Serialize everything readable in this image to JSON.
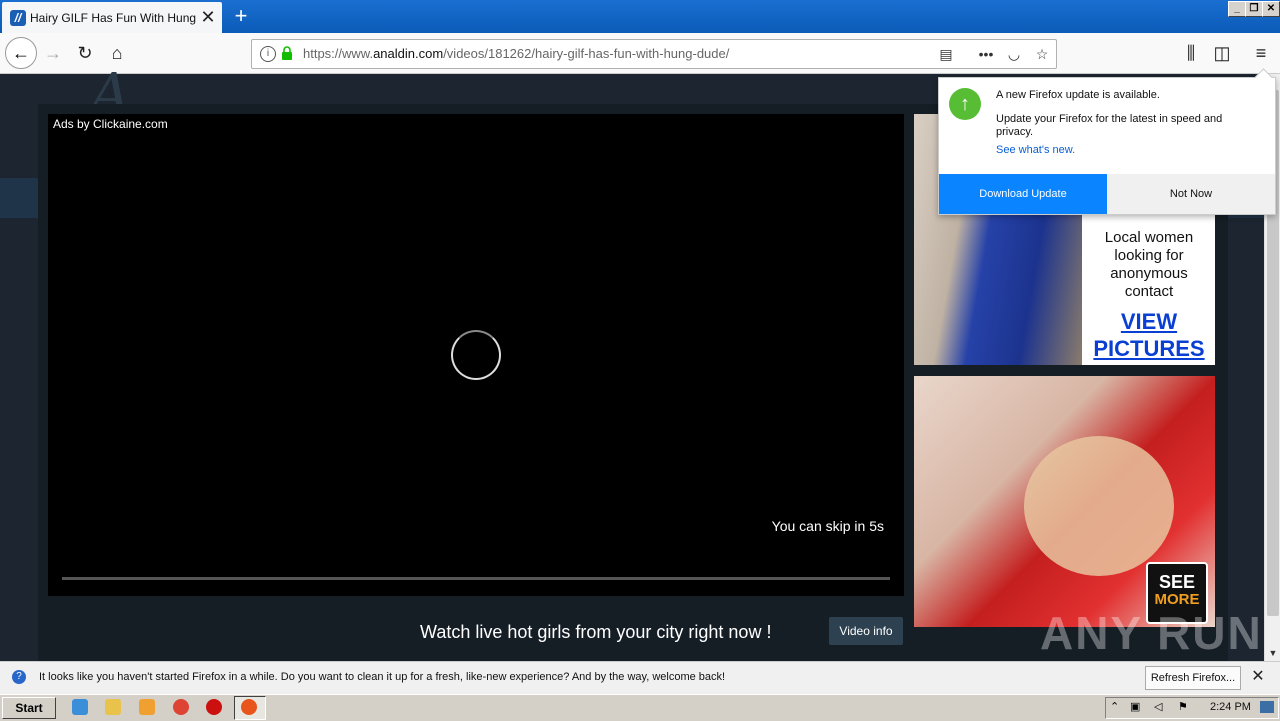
{
  "browser": {
    "tab_title": "Hairy GILF Has Fun With Hung Dude",
    "tab_favicon": "//",
    "new_tab_label": "+",
    "url_scheme": "https://www.",
    "url_domain": "analdin.com",
    "url_path": "/videos/181262/hairy-gilf-has-fun-with-hung-dude/"
  },
  "player": {
    "ads_by": "Ads by Clickaine.com",
    "skip_text": "You can skip in 5s"
  },
  "below_player": {
    "cta": "Watch live hot girls from your city right now !",
    "video_info": "Video info"
  },
  "ad1": {
    "text": "Local women looking for anonymous contact",
    "link": "VIEW PICTURES"
  },
  "ad2": {
    "see": "SEE",
    "more": "MORE"
  },
  "update_popup": {
    "title": "A new Firefox update is available.",
    "body": "Update your Firefox for the latest in speed and privacy.",
    "link": "See what's new.",
    "download": "Download Update",
    "not_now": "Not Now"
  },
  "notification": {
    "text": "It looks like you haven't started Firefox in a while. Do you want to clean it up for a fresh, like-new experience? And by the way, welcome back!",
    "refresh": "Refresh Firefox..."
  },
  "taskbar": {
    "start": "Start",
    "clock": "2:24 PM"
  },
  "watermark": "ANY RUN",
  "colors": {
    "accent": "#0a84ff",
    "update_green": "#57bd35",
    "page_bg": "#1c2530"
  }
}
